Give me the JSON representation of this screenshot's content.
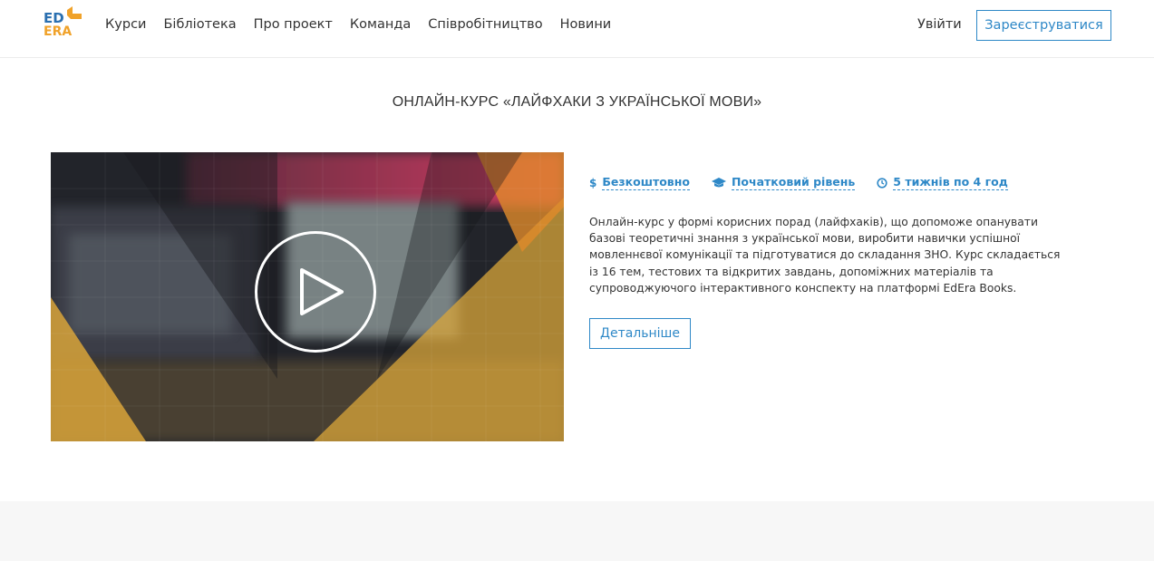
{
  "logo": {
    "line1": "ED",
    "line2": "ERA"
  },
  "nav": {
    "items": [
      {
        "label": "Курси"
      },
      {
        "label": "Бібліотека"
      },
      {
        "label": "Про проект"
      },
      {
        "label": "Команда"
      },
      {
        "label": "Співробітництво"
      },
      {
        "label": "Новини"
      }
    ],
    "login_label": "Увійти",
    "register_label": "Зареєструватися"
  },
  "course": {
    "title": "ОНЛАЙН-КУРС «ЛАЙФХАКИ З УКРАЇНСЬКОЇ МОВИ»",
    "meta": {
      "price_icon": "dollar-icon",
      "price": "Безкоштовно",
      "level_icon": "graduation-cap-icon",
      "level": "Початковий рівень",
      "duration_icon": "clock-icon",
      "duration": "5 тижнів по 4 год"
    },
    "description": "Онлайн-курс у формі корисних порад (лайфхаків), що допоможе опанувати базові теоретичні знання з української мови, виробити навички успішної мовленнєвої комунікації та підготуватися до складання ЗНО. Курс складається із 16 тем, тестових та відкритих завдань, допоміжних матеріалів та супроводжуючого інтерактивного конспекту на платформі EdEra Books.",
    "more_label": "Детальніше"
  },
  "colors": {
    "accent": "#2e88c7",
    "logo_blue": "#2a6fb0",
    "logo_orange": "#f0a22a",
    "video_gold": "#d9a53a",
    "video_pink": "#c9385c"
  }
}
